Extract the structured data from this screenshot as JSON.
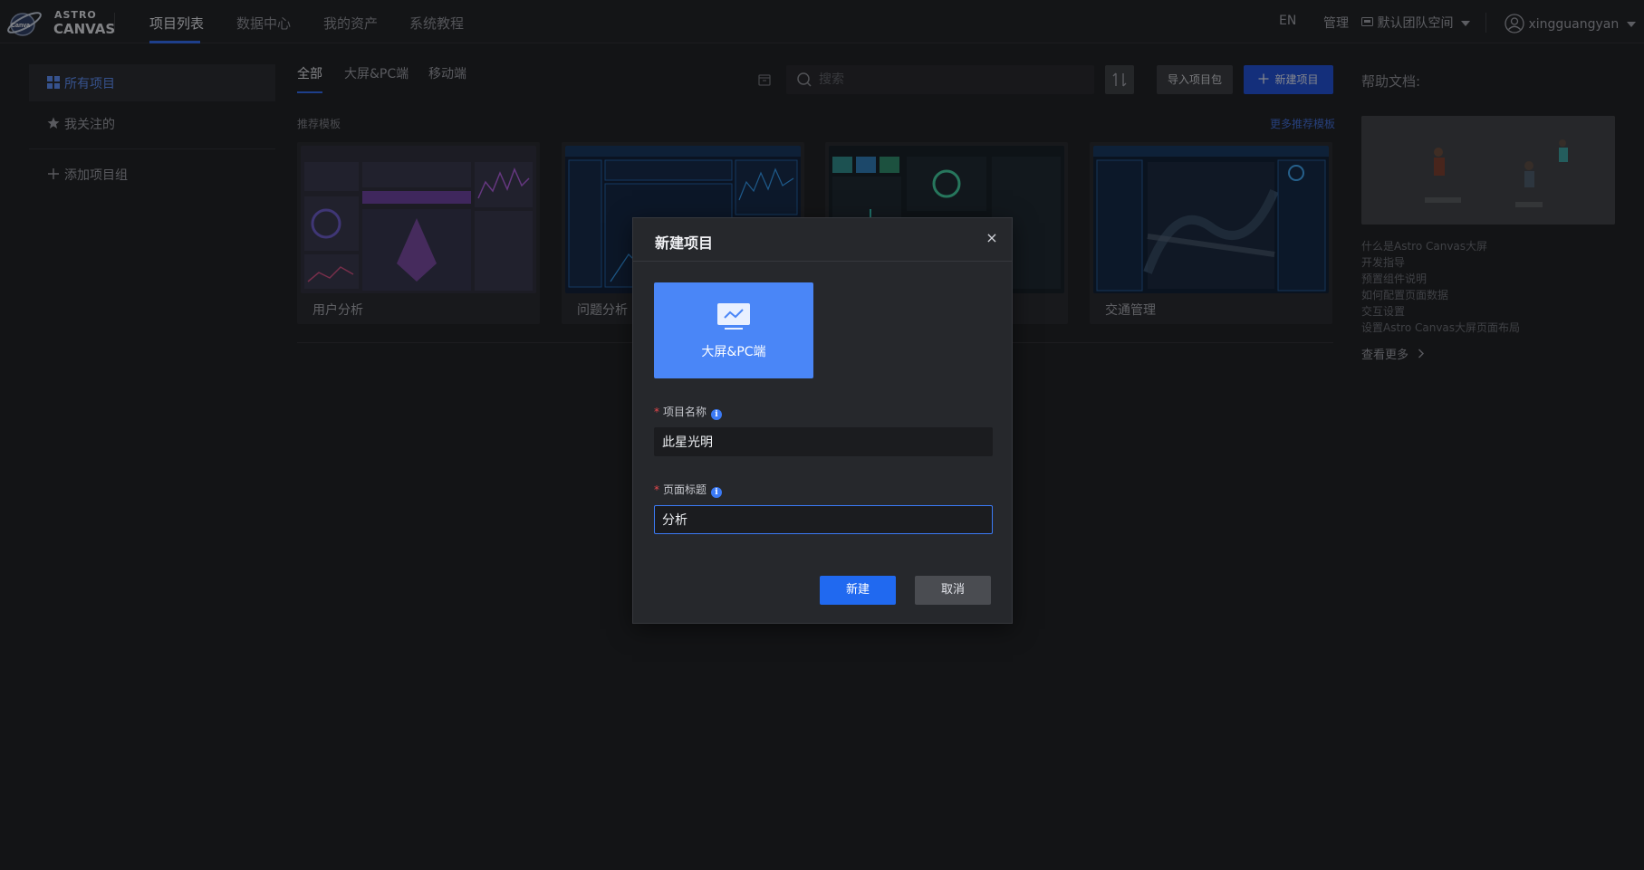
{
  "brand": {
    "line1": "ASTRO",
    "line2": "CANVAS"
  },
  "nav": {
    "tabs": [
      {
        "label": "项目列表",
        "active": true
      },
      {
        "label": "数据中心"
      },
      {
        "label": "我的资产"
      },
      {
        "label": "系统教程"
      }
    ],
    "lang": "EN",
    "manage": "管理",
    "team": "默认团队空间",
    "user": "xingguangyan"
  },
  "sidebar": {
    "items": [
      {
        "label": "所有项目",
        "icon": "grid-icon",
        "active": true
      },
      {
        "label": "我关注的",
        "icon": "star-icon"
      }
    ],
    "add_group": "添加项目组"
  },
  "filters": {
    "tabs": [
      "全部",
      "大屏&PC端",
      "移动端"
    ]
  },
  "search": {
    "placeholder": "搜索",
    "value": ""
  },
  "toolbar": {
    "import_label": "导入项目包",
    "new_label": "新建项目"
  },
  "templates": {
    "section_title": "推荐模板",
    "more_label": "更多推荐模板",
    "cards": [
      {
        "name": "用户分析"
      },
      {
        "name": "问题分析"
      },
      {
        "name": ""
      },
      {
        "name": "交通管理"
      }
    ]
  },
  "help": {
    "title": "帮助文档:",
    "links": [
      "什么是Astro Canvas大屏",
      "开发指导",
      "预置组件说明",
      "如何配置页面数据",
      "交互设置",
      "设置Astro Canvas大屏页面布局"
    ],
    "more": "查看更多"
  },
  "modal": {
    "title": "新建项目",
    "close": "×",
    "type_option": "大屏&PC端",
    "fields": {
      "name_label": "项目名称",
      "name_value": "此星光明",
      "title_label": "页面标题",
      "title_value": "分析"
    },
    "ok_label": "新建",
    "cancel_label": "取消"
  },
  "colors": {
    "accent": "#2f6bf5",
    "primary_button": "#2069f0",
    "type_card": "#4a86f7",
    "background": "#1b1c1f",
    "required": "#e5484d"
  }
}
